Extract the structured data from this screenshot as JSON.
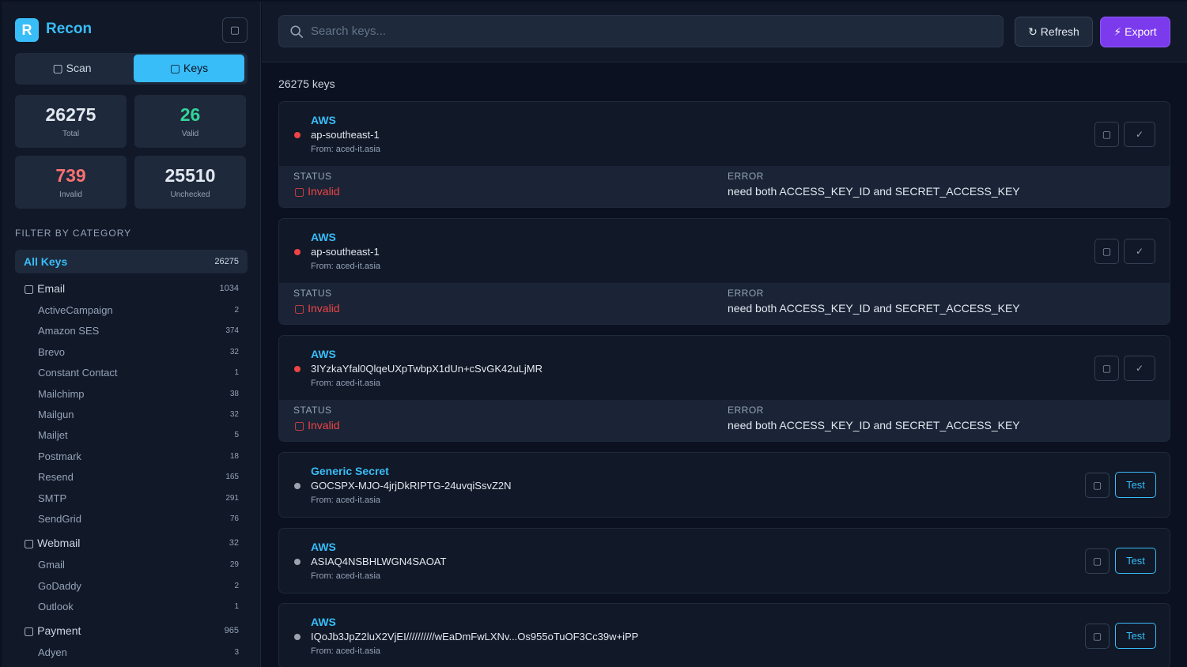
{
  "app": {
    "logo_letter": "R",
    "title": "Recon",
    "panel_toggle_icon": "panel-icon",
    "tabs": [
      {
        "label": "▢ Scan",
        "active": false
      },
      {
        "label": "▢ Keys",
        "active": true
      }
    ]
  },
  "stats": {
    "total": {
      "value": "26275",
      "label": "Total",
      "color": "#e2e8f0"
    },
    "valid": {
      "value": "26",
      "label": "Valid",
      "color": "#34d399"
    },
    "invalid": {
      "value": "739",
      "label": "Invalid",
      "color": "#f87171"
    },
    "unchecked": {
      "value": "25510",
      "label": "Unchecked",
      "color": "#e2e8f0"
    }
  },
  "filter": {
    "title": "FILTER BY CATEGORY",
    "all": {
      "name": "All Keys",
      "count": "26275"
    },
    "groups": [
      {
        "name": "▢  Email",
        "count": "1034",
        "items": [
          {
            "name": "ActiveCampaign",
            "count": "2"
          },
          {
            "name": "Amazon SES",
            "count": "374"
          },
          {
            "name": "Brevo",
            "count": "32"
          },
          {
            "name": "Constant Contact",
            "count": "1"
          },
          {
            "name": "Mailchimp",
            "count": "38"
          },
          {
            "name": "Mailgun",
            "count": "32"
          },
          {
            "name": "Mailjet",
            "count": "5"
          },
          {
            "name": "Postmark",
            "count": "18"
          },
          {
            "name": "Resend",
            "count": "165"
          },
          {
            "name": "SMTP",
            "count": "291"
          },
          {
            "name": "SendGrid",
            "count": "76"
          }
        ]
      },
      {
        "name": "▢  Webmail",
        "count": "32",
        "items": [
          {
            "name": "Gmail",
            "count": "29"
          },
          {
            "name": "GoDaddy",
            "count": "2"
          },
          {
            "name": "Outlook",
            "count": "1"
          }
        ]
      },
      {
        "name": "▢  Payment",
        "count": "965",
        "items": [
          {
            "name": "Adyen",
            "count": "3"
          }
        ]
      }
    ]
  },
  "toolbar": {
    "search_placeholder": "Search keys...",
    "search_value": "",
    "refresh_label": "↻ Refresh",
    "export_label": "⚡ Export"
  },
  "main": {
    "keys_count": "26275 keys",
    "status_label": "STATUS",
    "error_label": "ERROR",
    "test_label": "Test",
    "cards": [
      {
        "provider": "AWS",
        "key": "ap-southeast-1",
        "from": "From: aced-it.asia",
        "state": "invalid",
        "status": "▢ Invalid",
        "error": "need both ACCESS_KEY_ID and SECRET_ACCESS_KEY"
      },
      {
        "provider": "AWS",
        "key": "ap-southeast-1",
        "from": "From: aced-it.asia",
        "state": "invalid",
        "status": "▢ Invalid",
        "error": "need both ACCESS_KEY_ID and SECRET_ACCESS_KEY"
      },
      {
        "provider": "AWS",
        "key": "3IYzkaYfal0QlqeUXpTwbpX1dUn+cSvGK42uLjMR",
        "from": "From: aced-it.asia",
        "state": "invalid",
        "status": "▢ Invalid",
        "error": "need both ACCESS_KEY_ID and SECRET_ACCESS_KEY"
      },
      {
        "provider": "Generic Secret",
        "key": "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",
        "from": "From: aced-it.asia",
        "state": "unchecked"
      },
      {
        "provider": "AWS",
        "key": "ASIAQ4NSBHLWGN4SAOAT",
        "from": "From: aced-it.asia",
        "state": "unchecked"
      },
      {
        "provider": "AWS",
        "key": "IQoJb3JpZ2luX2VjEI//////////wEaDmFwLXNv...Os955oTuOF3Cc39w+iPP",
        "from": "From: aced-it.asia",
        "state": "unchecked"
      }
    ]
  },
  "colors": {
    "accent": "#38bdf8",
    "export": "#7c3aed",
    "invalid": "#ef4444",
    "valid": "#34d399",
    "background": "#0b1120",
    "panel": "#111827"
  }
}
